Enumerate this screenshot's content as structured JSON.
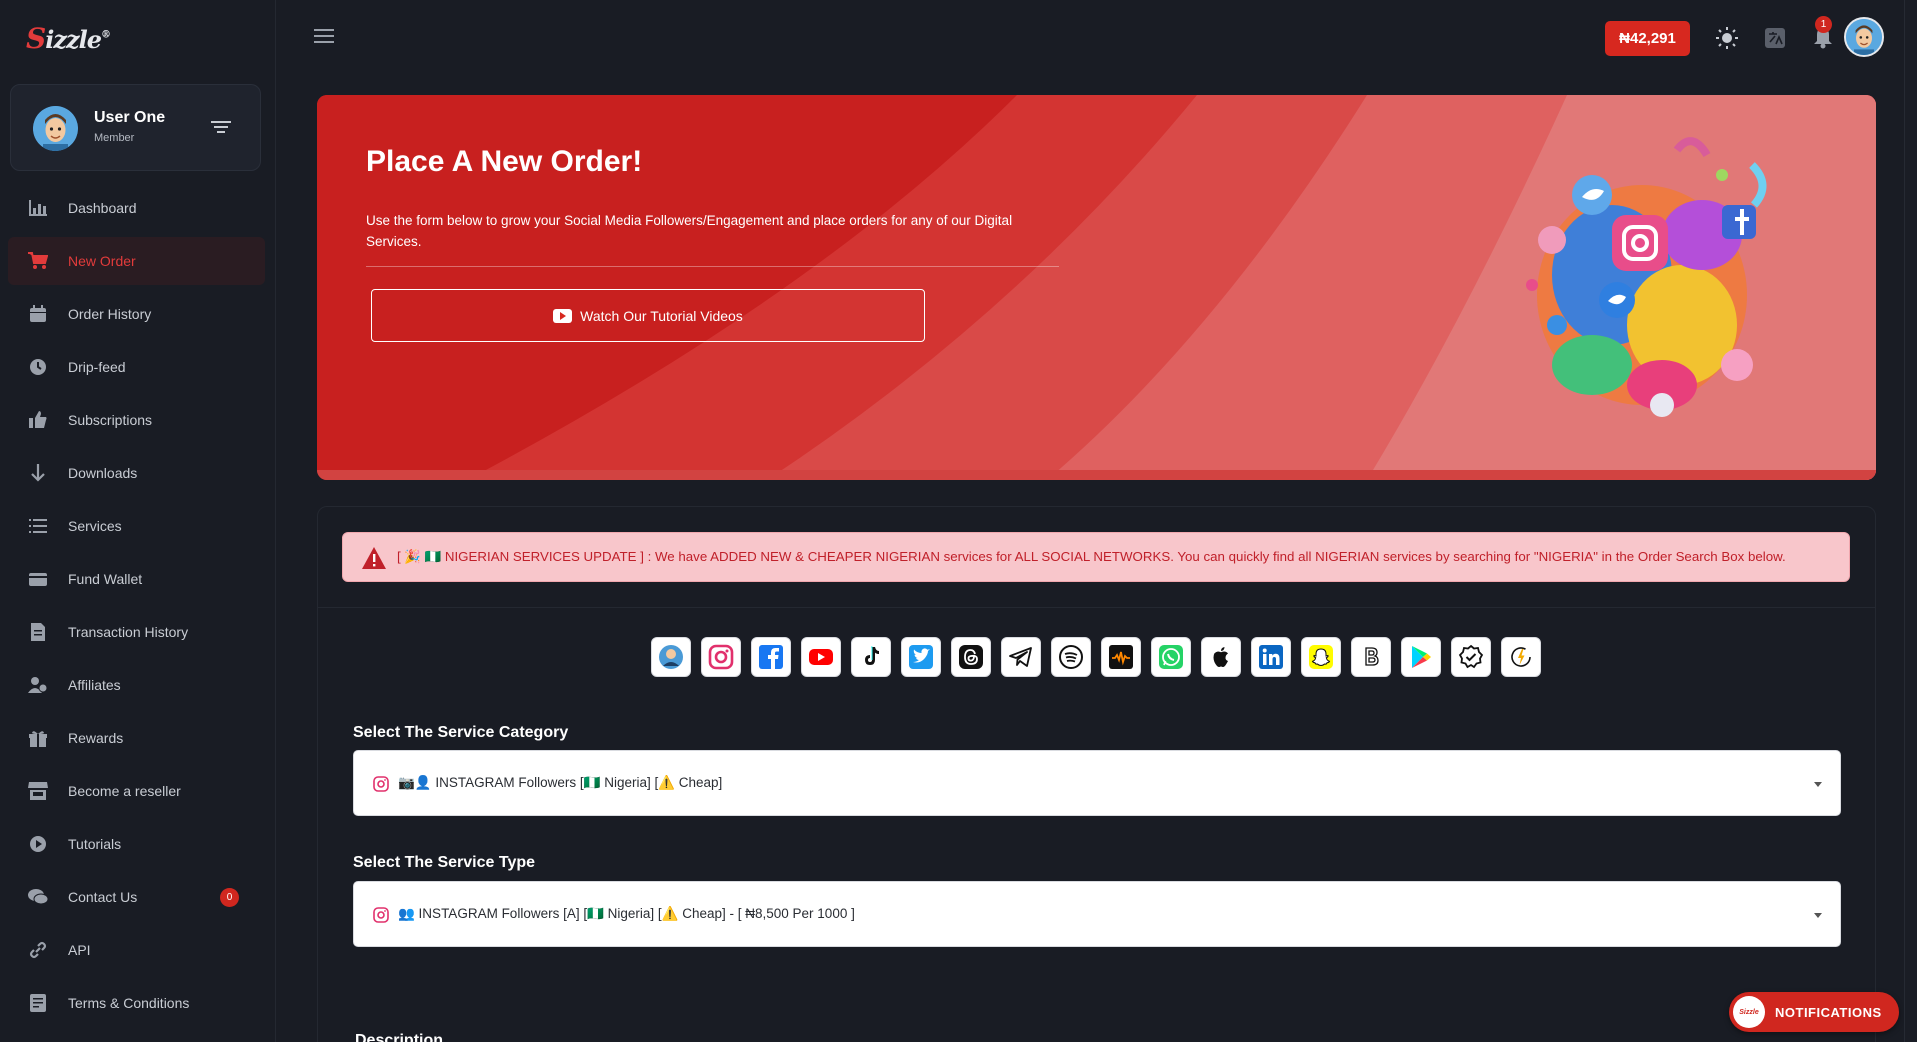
{
  "brand": {
    "logo_s": "S",
    "logo_rest": "izzle",
    "logo_mark": "®"
  },
  "user": {
    "name": "User One",
    "role": "Member"
  },
  "sidebar": {
    "items": [
      {
        "label": "Dashboard",
        "icon": "chart-bar-icon"
      },
      {
        "label": "New Order",
        "icon": "cart-icon",
        "active": true
      },
      {
        "label": "Order History",
        "icon": "calendar-icon"
      },
      {
        "label": "Drip-feed",
        "icon": "clock-icon"
      },
      {
        "label": "Subscriptions",
        "icon": "thumbs-up-icon"
      },
      {
        "label": "Downloads",
        "icon": "arrow-down-icon"
      },
      {
        "label": "Services",
        "icon": "list-icon"
      },
      {
        "label": "Fund Wallet",
        "icon": "wallet-icon"
      },
      {
        "label": "Transaction History",
        "icon": "receipt-icon"
      },
      {
        "label": "Affiliates",
        "icon": "users-icon"
      },
      {
        "label": "Rewards",
        "icon": "gift-icon"
      },
      {
        "label": "Become a reseller",
        "icon": "store-icon"
      },
      {
        "label": "Tutorials",
        "icon": "play-circle-icon"
      },
      {
        "label": "Contact Us",
        "icon": "chat-icon",
        "badge": "0"
      },
      {
        "label": "API",
        "icon": "link-icon"
      },
      {
        "label": "Terms & Conditions",
        "icon": "document-icon"
      }
    ]
  },
  "topbar": {
    "balance": "₦42,291",
    "notification_count": "1"
  },
  "hero": {
    "title": "Place A New Order!",
    "description": "Use the form below to grow your Social Media Followers/Engagement and place orders for any of our Digital Services.",
    "button_label": "Watch Our Tutorial Videos"
  },
  "alert": {
    "text": "[ 🎉 🇳🇬 NIGERIAN SERVICES UPDATE ] : We have ADDED NEW & CHEAPER NIGERIAN services for ALL SOCIAL NETWORKS. You can quickly find all NIGERIAN services by searching for \"NIGERIA\" in the Order Search Box below."
  },
  "platforms": [
    "profile",
    "instagram",
    "facebook",
    "youtube",
    "tiktok",
    "twitter",
    "threads",
    "telegram",
    "spotify",
    "audiomack",
    "whatsapp",
    "apple",
    "linkedin",
    "snapchat",
    "boomplay",
    "google-play",
    "verified",
    "other"
  ],
  "form": {
    "category_label": "Select The Service Category",
    "category_value": "📷👤 INSTAGRAM Followers [🇳🇬 Nigeria] [⚠️ Cheap]",
    "type_label": "Select The Service Type",
    "type_value": "👥 INSTAGRAM Followers [A] [🇳🇬 Nigeria] [⚠️ Cheap] - [ ₦8,500 Per 1000 ]",
    "description_label": "Description"
  },
  "notifications_button": {
    "label": "NOTIFICATIONS",
    "logo": "Sizzle"
  },
  "colors": {
    "accent": "#d7281f",
    "background": "#191c24",
    "alert_bg": "#f8c6cb",
    "alert_text": "#c0202a"
  }
}
